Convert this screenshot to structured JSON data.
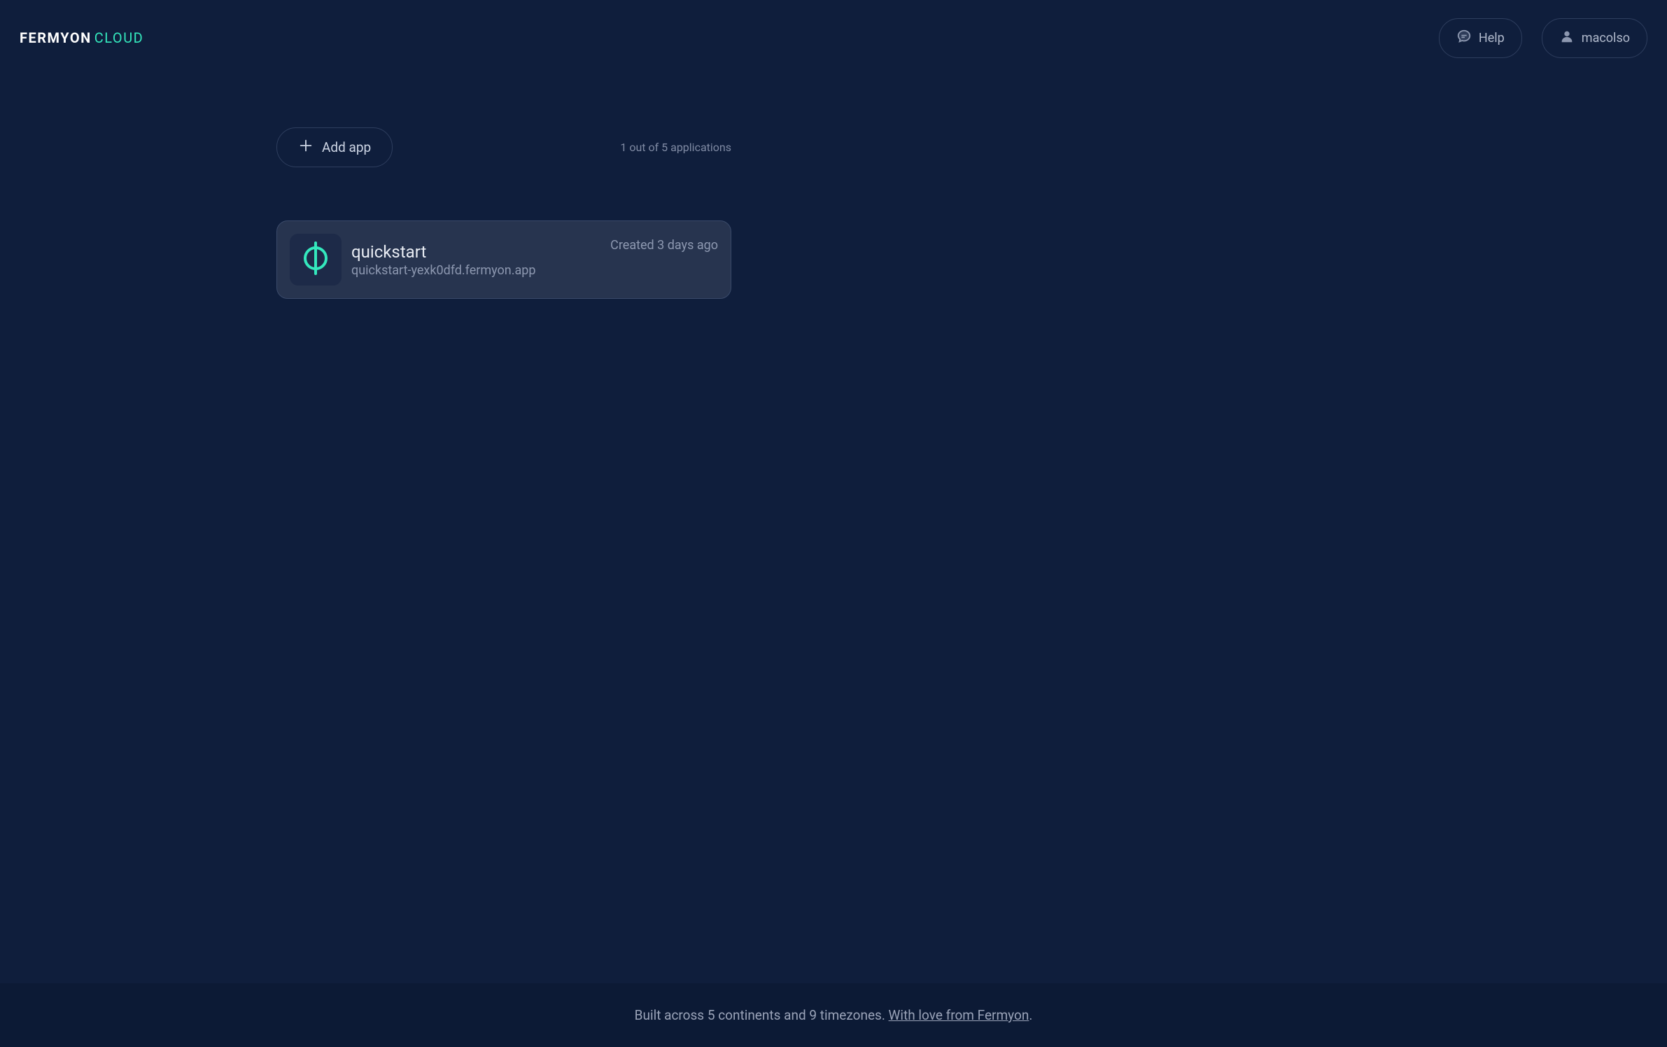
{
  "header": {
    "logo_fermyon": "FERMYON",
    "logo_cloud": "CLOUD",
    "help_label": "Help",
    "user_label": "macolso"
  },
  "toolbar": {
    "add_app_label": "Add app",
    "app_count": "1 out of 5 applications"
  },
  "app": {
    "name": "quickstart",
    "domain": "quickstart-yexk0dfd.fermyon.app",
    "created": "Created 3 days ago"
  },
  "footer": {
    "text_1": "Built across 5 continents and 9 timezones. ",
    "link_text": "With love from Fermyon",
    "text_2": "."
  }
}
